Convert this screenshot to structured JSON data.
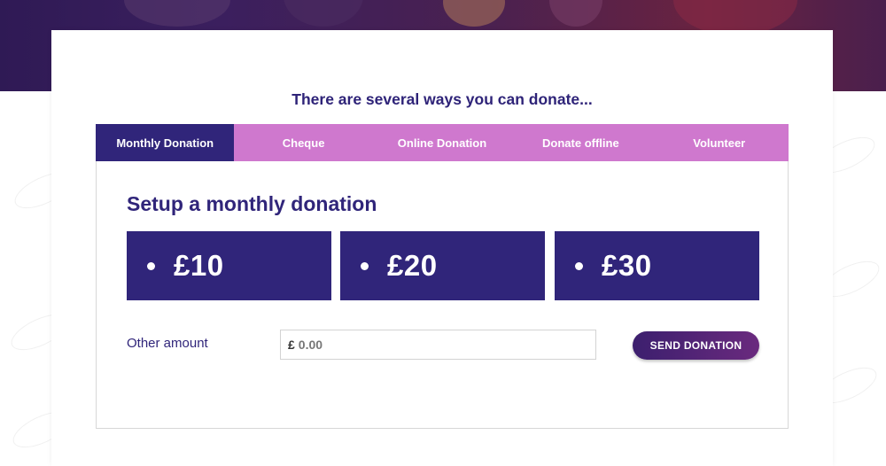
{
  "headline": "There are several ways you can donate...",
  "tabs": [
    {
      "label": "Monthly Donation",
      "active": true
    },
    {
      "label": "Cheque",
      "active": false
    },
    {
      "label": "Online Donation",
      "active": false
    },
    {
      "label": "Donate offline",
      "active": false
    },
    {
      "label": "Volunteer",
      "active": false
    }
  ],
  "panel": {
    "title": "Setup a monthly donation",
    "amounts": [
      "£10",
      "£20",
      "£30"
    ],
    "other_amount": {
      "label": "Other amount",
      "currency_symbol": "£",
      "placeholder": "0.00",
      "value": ""
    },
    "send_button": "SEND DONATION"
  },
  "colors": {
    "primary": "#30257a",
    "tab_bar": "#cf78ce",
    "button_gradient_start": "#3c1f6e",
    "button_gradient_end": "#6a2a7e"
  },
  "icons": {
    "amount_bullet": "bullet-icon"
  }
}
